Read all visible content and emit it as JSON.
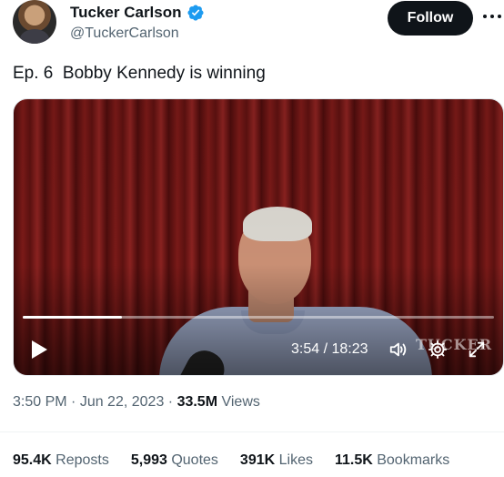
{
  "author": {
    "name": "Tucker Carlson",
    "handle": "@TuckerCarlson",
    "verified": true
  },
  "follow_label": "Follow",
  "tweet": {
    "text": "Ep. 6  Bobby Kennedy is winning"
  },
  "video": {
    "current_time": "3:54",
    "duration": "18:23",
    "time_separator": " / ",
    "watermark": "TUCKER",
    "progress_fraction": 0.21
  },
  "meta": {
    "time": "3:50 PM",
    "separator": " · ",
    "date": "Jun 22, 2023",
    "views_count": "33.5M",
    "views_label": " Views"
  },
  "stats": {
    "reposts_count": "95.4K",
    "reposts_label": " Reposts",
    "quotes_count": "5,993",
    "quotes_label": " Quotes",
    "likes_count": "391K",
    "likes_label": " Likes",
    "bookmarks_count": "11.5K",
    "bookmarks_label": " Bookmarks"
  },
  "colors": {
    "primary_text": "#0f1419",
    "secondary_text": "#536471",
    "verified_blue": "#1d9bf0",
    "follow_bg": "#0f1419"
  },
  "icons": {
    "verified": "verified-badge-icon",
    "more": "more-horizontal-icon",
    "play": "play-icon",
    "volume": "volume-icon",
    "settings": "gear-icon",
    "fullscreen": "fullscreen-icon"
  }
}
